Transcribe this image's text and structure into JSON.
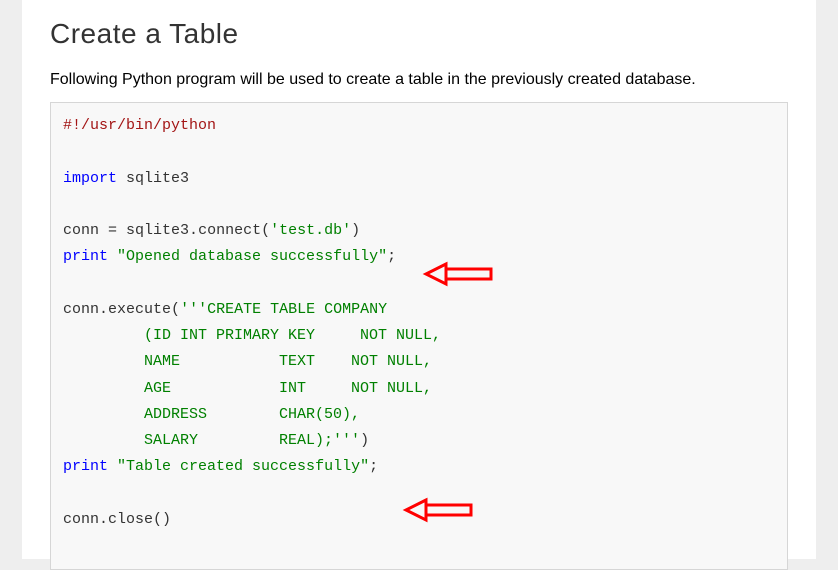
{
  "heading": "Create a Table",
  "intro": "Following Python program will be used to create a table in the previously created database.",
  "code": {
    "shebang": "#!/usr/bin/python",
    "kw_import": "import",
    "mod_sqlite3": " sqlite3",
    "line_conn_assign_a": "conn ",
    "op_eq": "=",
    "line_conn_assign_b": " sqlite3",
    "op_dot1": ".",
    "fn_connect": "connect",
    "op_paren_open1": "(",
    "str_testdb": "'test.db'",
    "op_paren_close1": ")",
    "kw_print1": "print",
    "sp1": " ",
    "str_opened": "\"Opened database successfully\"",
    "op_semi1": ";",
    "line_exec_a": "conn",
    "op_dot2": ".",
    "fn_execute": "execute",
    "op_paren_open2": "(",
    "str_create": "'''CREATE TABLE COMPANY\n         (ID INT PRIMARY KEY     NOT NULL,\n         NAME           TEXT    NOT NULL,\n         AGE            INT     NOT NULL,\n         ADDRESS        CHAR(50),\n         SALARY         REAL);'''",
    "op_paren_close2": ")",
    "kw_print2": "print",
    "sp2": " ",
    "str_table_created": "\"Table created successfully\"",
    "op_semi2": ";",
    "line_close_a": "conn",
    "op_dot3": ".",
    "fn_close": "close",
    "op_parens3": "()"
  },
  "annotations": {
    "arrow1_color": "#ff0000",
    "arrow2_color": "#ff0000"
  }
}
